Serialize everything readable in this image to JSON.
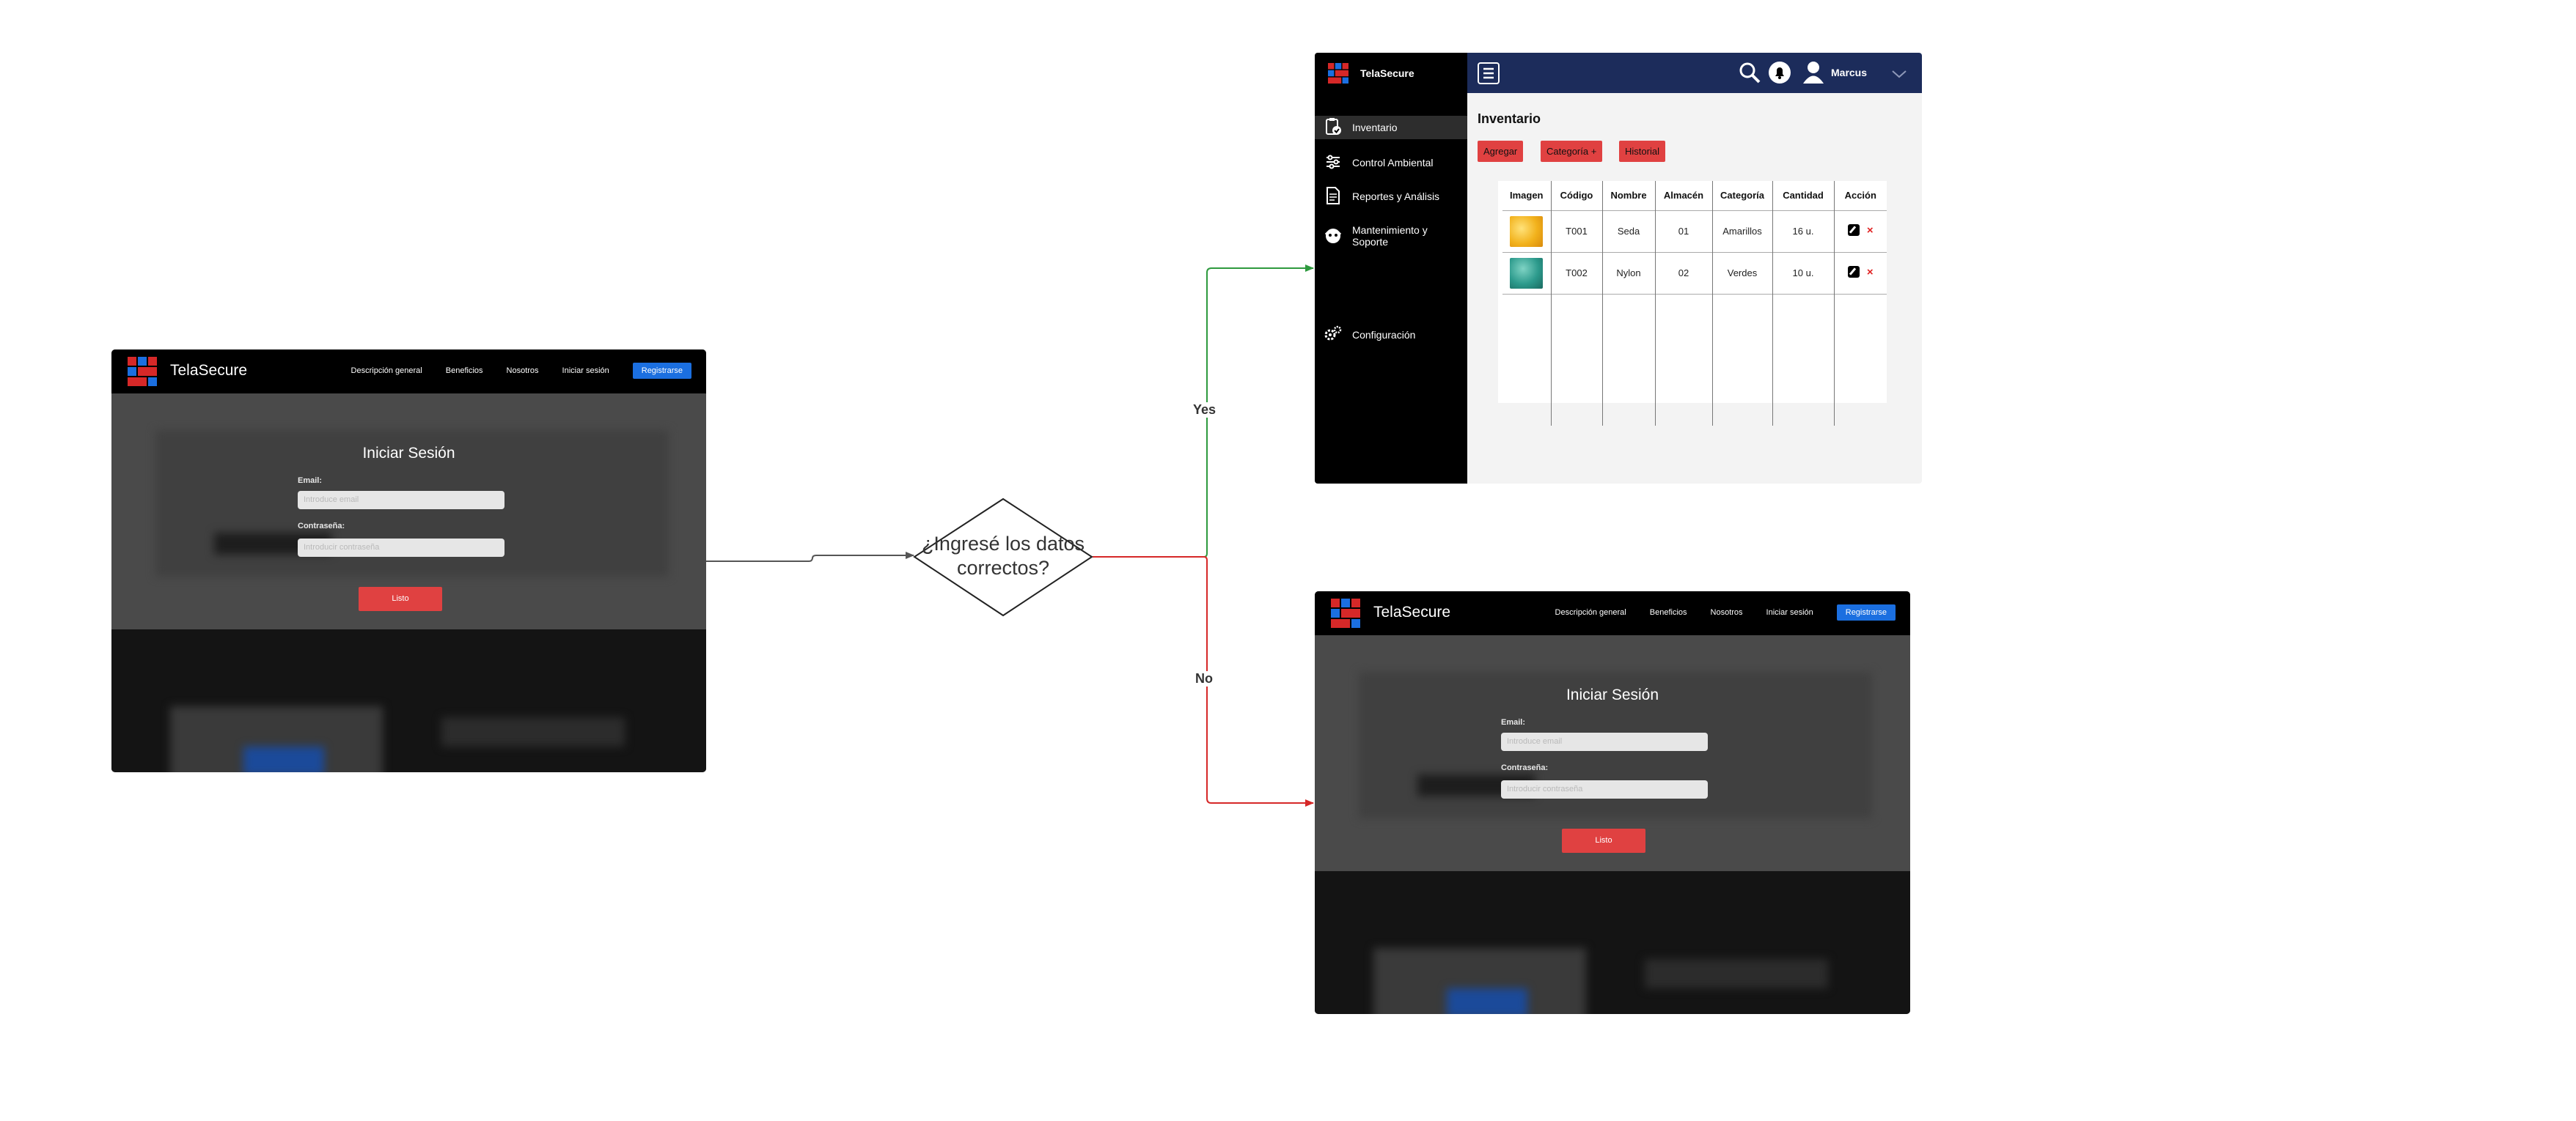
{
  "login_screen": {
    "brand": "TelaSecure",
    "nav_links": [
      "Descripción general",
      "Beneficios",
      "Nosotros",
      "Iniciar sesión"
    ],
    "register_button": "Registrarse",
    "form_title": "Iniciar Sesión",
    "email_label": "Email:",
    "email_placeholder": "Introduce email",
    "password_label": "Contraseña:",
    "password_placeholder": "Introducir contraseña",
    "submit_button": "Listo"
  },
  "decision": {
    "line1": "¿Ingresé los datos",
    "line2": "correctos?"
  },
  "edges": {
    "yes_label": "Yes",
    "no_label": "No",
    "yes_color": "#2e9a3e",
    "no_color": "#d62828",
    "default_color": "#555555"
  },
  "inventory_screen": {
    "brand": "TelaSecure",
    "user_name": "Marcus",
    "sidebar_items": [
      {
        "label": "Inventario",
        "icon": "clipboard-check-icon"
      },
      {
        "label": "Control Ambiental",
        "icon": "sliders-icon"
      },
      {
        "label": "Reportes y Análisis",
        "icon": "document-icon"
      },
      {
        "label": "Mantenimiento y Soporte",
        "icon": "support-icon"
      },
      {
        "label": "Configuración",
        "icon": "gears-icon"
      }
    ],
    "page_title": "Inventario",
    "action_buttons": [
      "Agregar",
      "Categoría +",
      "Historial"
    ],
    "table": {
      "headers": [
        "Imagen",
        "Código",
        "Nombre",
        "Almacén",
        "Categoría",
        "Cantidad",
        "Acción"
      ],
      "rows": [
        {
          "code": "T001",
          "name": "Seda",
          "warehouse": "01",
          "category": "Amarillos",
          "quantity": "16 u.",
          "thumb_color": "#f2b21c"
        },
        {
          "code": "T002",
          "name": "Nylon",
          "warehouse": "02",
          "category": "Verdes",
          "quantity": "10 u.",
          "thumb_color": "#2c9a8c"
        }
      ]
    }
  },
  "colors": {
    "accent_red": "#e04141",
    "register_blue": "#1b6fe0",
    "inventory_topbar": "#1c2c5b"
  }
}
